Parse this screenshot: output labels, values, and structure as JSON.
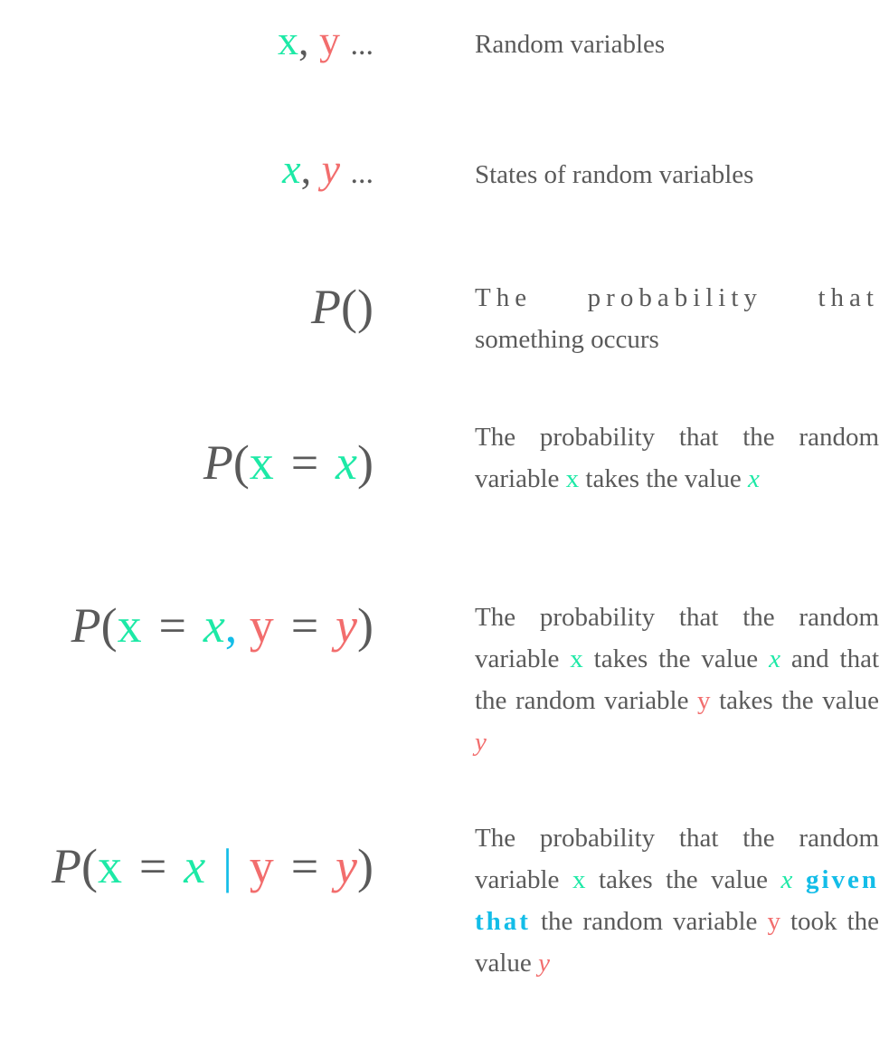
{
  "colors": {
    "text": "#5a5a5a",
    "x_var": "#1de9a6",
    "y_var": "#f26d6d",
    "connector": "#13bde8"
  },
  "rows": [
    {
      "symbol": {
        "x": "x",
        "sep": ",",
        "y": "y",
        "ellipsis": "..."
      },
      "description": "Random variables"
    },
    {
      "symbol": {
        "x": "x",
        "sep": ",",
        "y": "y",
        "ellipsis": "..."
      },
      "description": "States of random variables"
    },
    {
      "symbol": {
        "P": "P",
        "open": "(",
        "close": ")"
      },
      "description": {
        "line1": "The probability that",
        "line2": "something occurs"
      }
    },
    {
      "symbol": {
        "P": "P",
        "open": "(",
        "rv": "x",
        "eq": "=",
        "val": "x",
        "close": ")"
      },
      "description": {
        "t1": "The probability that the random variable",
        "rv": "x",
        "t2": "takes the value",
        "val": "x"
      }
    },
    {
      "symbol": {
        "P": "P",
        "open": "(",
        "rv1": "x",
        "eq1": "=",
        "val1": "x",
        "sep": ",",
        "rv2": "y",
        "eq2": "=",
        "val2": "y",
        "close": ")"
      },
      "description": {
        "t1": "The probability that the random variable",
        "rv1": "x",
        "t2": "takes the value",
        "val1": "x",
        "t3": "and that the random variable",
        "rv2": "y",
        "t4": "takes the value",
        "val2": "y"
      }
    },
    {
      "symbol": {
        "P": "P",
        "open": "(",
        "rv1": "x",
        "eq1": "=",
        "val1": "x",
        "bar": "|",
        "rv2": "y",
        "eq2": "=",
        "val2": "y",
        "close": ")"
      },
      "description": {
        "t1": "The probability that the random variable",
        "rv1": "x",
        "t2": "takes the value",
        "val1": "x",
        "emph": "given that",
        "t3": "the random variable",
        "rv2": "y",
        "t4": "took the value",
        "val2": "y"
      }
    }
  ]
}
